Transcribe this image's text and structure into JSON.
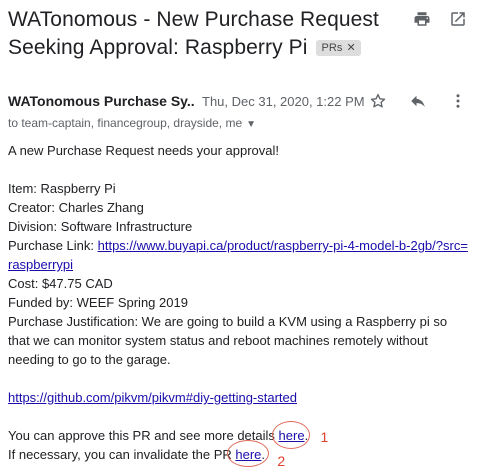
{
  "email": {
    "subject": "WATonomous - New Purchase Request Seeking Approval: Raspberry Pi",
    "label": "PRs",
    "sender": "WATonomous Purchase Sy...",
    "date": "Thu, Dec 31, 2020, 1:22 PM",
    "recipients": "to team-captain, financegroup, drayside, me",
    "body": {
      "intro": "A new Purchase Request needs your approval!",
      "item": "Item: Raspberry Pi",
      "creator": "Creator: Charles Zhang",
      "division": "Division: Software Infrastructure",
      "purchase_link_label": "Purchase Link: ",
      "purchase_link": "https://www.buyapi.ca/product/raspberry-pi-4-model-b-2gb/?src=raspberrypi",
      "cost": "Cost: $47.75 CAD",
      "funded_by": "Funded by: WEEF Spring 2019",
      "justification": "Purchase Justification: We are going to build a KVM using a Raspberry pi so that we can monitor system status and reboot machines remotely without needing to go to the garage.",
      "github_link": "https://github.com/pikvm/pikvm#diy-getting-started",
      "approve_prefix": "You can approve this PR and see more details ",
      "approve_link": "here",
      "approve_suffix": ".",
      "invalidate_prefix": "If necessary, you can invalidate the PR ",
      "invalidate_link": "here",
      "invalidate_suffix": "."
    }
  },
  "annotations": {
    "one": "1",
    "two": "2",
    "color": "#e0412f"
  },
  "icons": {
    "print": "print-icon",
    "open_new_window": "open-in-new-window-icon",
    "star": "star-icon",
    "reply": "reply-icon",
    "more": "more-vert-icon",
    "label_close": "close-icon",
    "caret": "chevron-down-icon"
  }
}
